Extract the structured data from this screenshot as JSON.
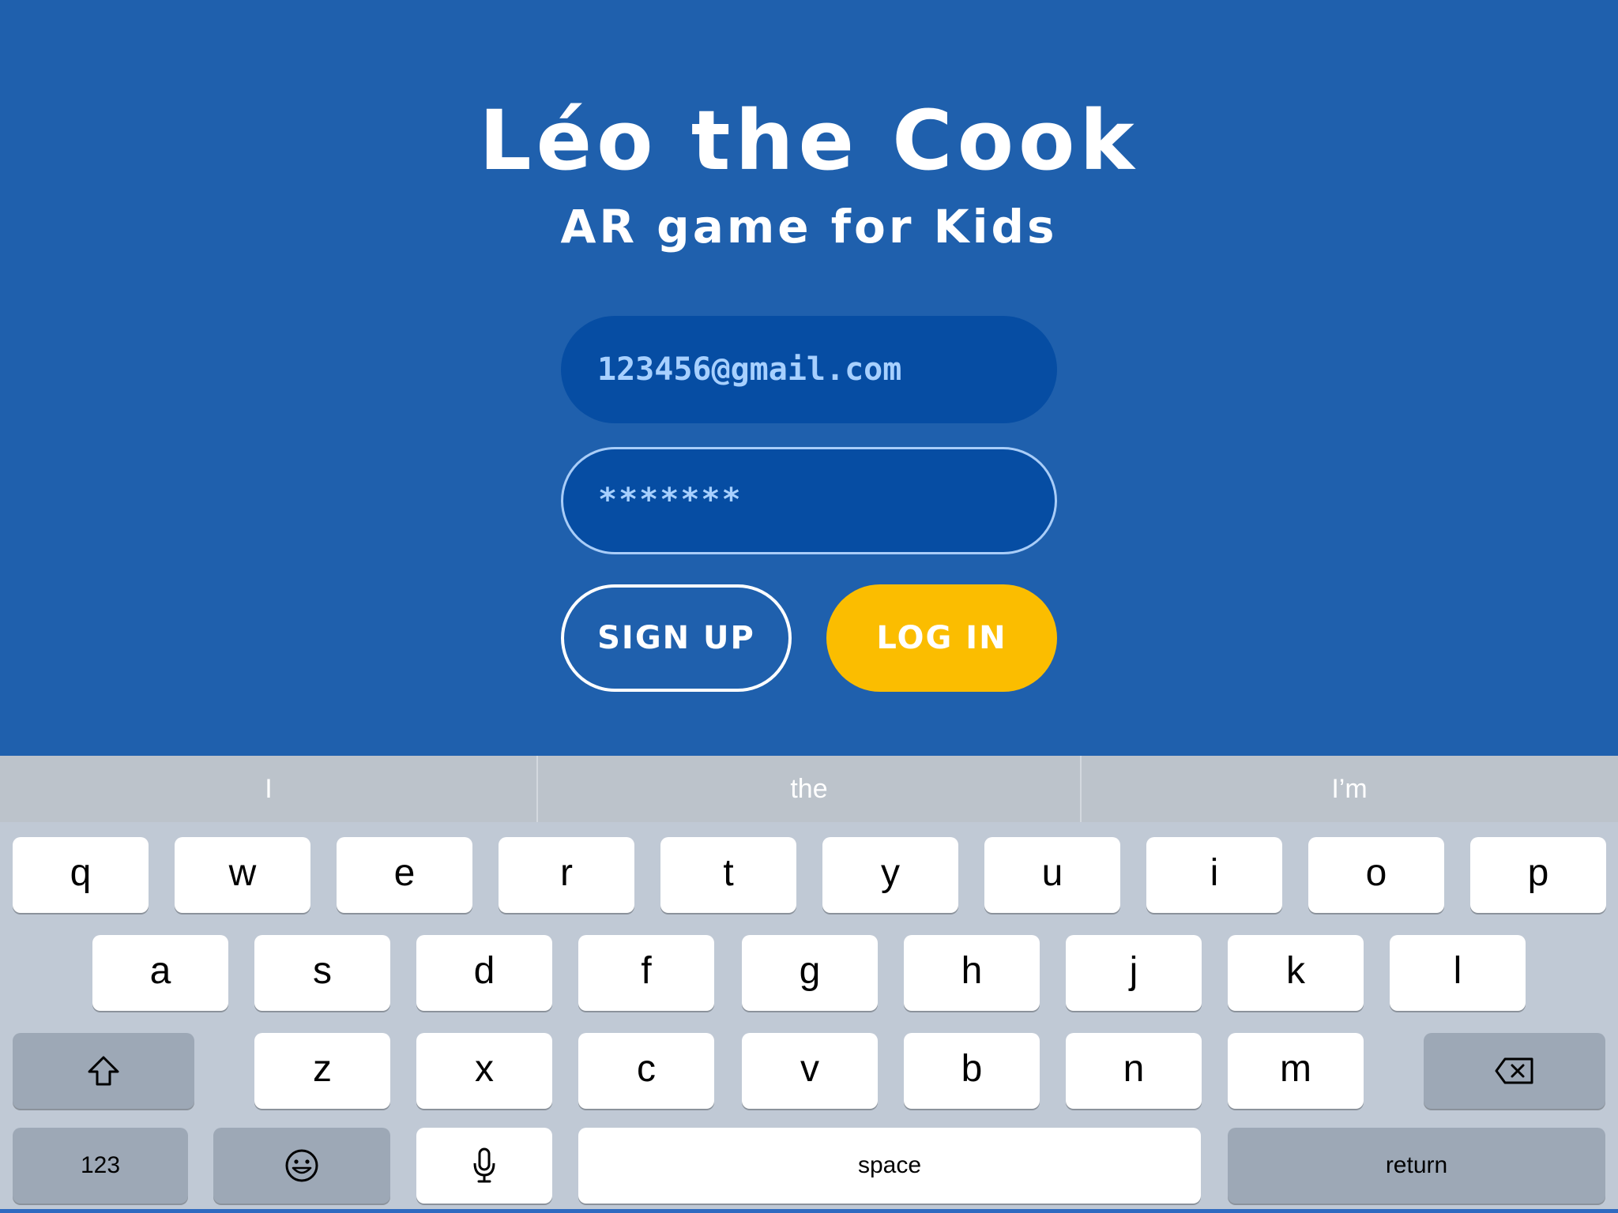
{
  "app": {
    "title": "Léo the Cook",
    "subtitle": "AR game for Kids",
    "email_value": "123456@gmail.com",
    "password_value": "*******",
    "signup_label": "SIGN UP",
    "login_label": "LOG IN",
    "colors": {
      "background": "#1f60ad",
      "field": "#064da3",
      "field_text": "#a7d0ff",
      "login_button": "#fbbd00"
    }
  },
  "keyboard": {
    "suggestions": [
      "I",
      "the",
      "I’m"
    ],
    "row1": [
      "q",
      "w",
      "e",
      "r",
      "t",
      "y",
      "u",
      "i",
      "o",
      "p"
    ],
    "row2": [
      "a",
      "s",
      "d",
      "f",
      "g",
      "h",
      "j",
      "k",
      "l"
    ],
    "row3": [
      "z",
      "x",
      "c",
      "v",
      "b",
      "n",
      "m"
    ],
    "numbers_label": "123",
    "space_label": "space",
    "return_label": "return",
    "icons": [
      "shift-icon",
      "backspace-icon",
      "emoji-icon",
      "microphone-icon"
    ]
  }
}
